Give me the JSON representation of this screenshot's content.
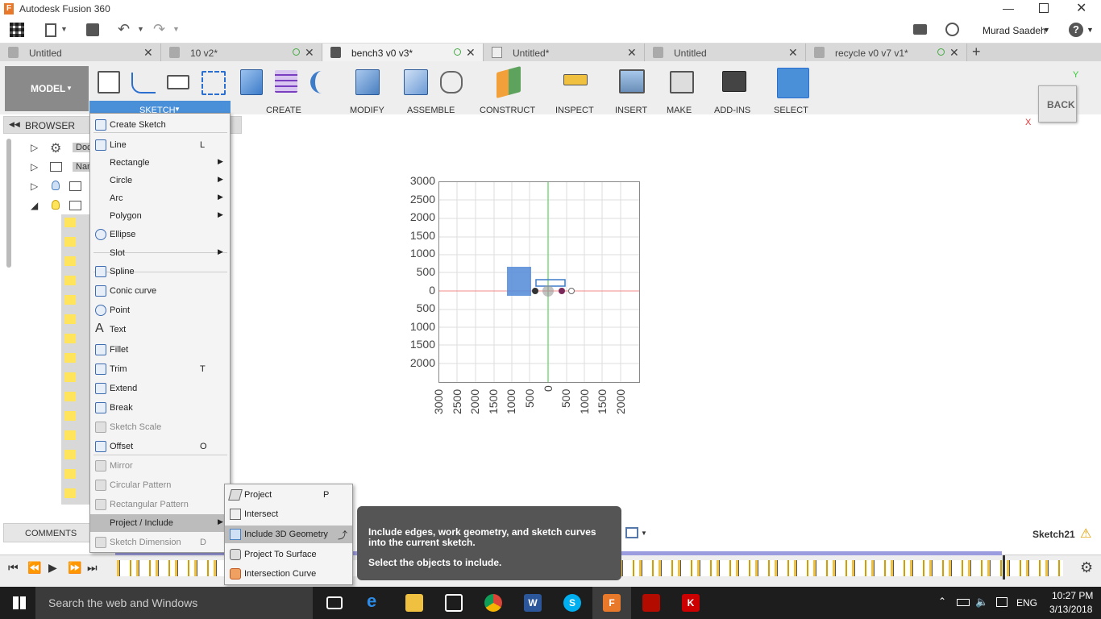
{
  "app": {
    "title": "Autodesk Fusion 360",
    "user": "Murad Saadeh"
  },
  "tabs": [
    {
      "label": "Untitled"
    },
    {
      "label": "10 v2*"
    },
    {
      "label": "bench3 v0 v3*"
    },
    {
      "label": "Untitled*"
    },
    {
      "label": "Untitled"
    },
    {
      "label": "recycle v0 v7 v1*"
    }
  ],
  "ribbon": {
    "workspace": "MODEL",
    "groups": [
      "SKETCH",
      "CREATE",
      "MODIFY",
      "ASSEMBLE",
      "CONSTRUCT",
      "INSPECT",
      "INSERT",
      "MAKE",
      "ADD-INS",
      "SELECT"
    ]
  },
  "browser": {
    "title": "BROWSER",
    "rows": [
      "Doc",
      "Nam"
    ]
  },
  "comments": {
    "label": "COMMENTS"
  },
  "sketch_menu": {
    "items": [
      {
        "label": "Create Sketch",
        "shortcut": "",
        "submenu": false,
        "disabled": false
      },
      {
        "label": "Line",
        "shortcut": "L",
        "submenu": false,
        "disabled": false
      },
      {
        "label": "Rectangle",
        "shortcut": "",
        "submenu": true,
        "disabled": false
      },
      {
        "label": "Circle",
        "shortcut": "",
        "submenu": true,
        "disabled": false
      },
      {
        "label": "Arc",
        "shortcut": "",
        "submenu": true,
        "disabled": false
      },
      {
        "label": "Polygon",
        "shortcut": "",
        "submenu": true,
        "disabled": false
      },
      {
        "label": "Ellipse",
        "shortcut": "",
        "submenu": false,
        "disabled": false
      },
      {
        "label": "Slot",
        "shortcut": "",
        "submenu": true,
        "disabled": false
      },
      {
        "label": "Spline",
        "shortcut": "",
        "submenu": false,
        "disabled": false
      },
      {
        "label": "Conic curve",
        "shortcut": "",
        "submenu": false,
        "disabled": false
      },
      {
        "label": "Point",
        "shortcut": "",
        "submenu": false,
        "disabled": false
      },
      {
        "label": "Text",
        "shortcut": "",
        "submenu": false,
        "disabled": false
      },
      {
        "label": "Fillet",
        "shortcut": "",
        "submenu": false,
        "disabled": false
      },
      {
        "label": "Trim",
        "shortcut": "T",
        "submenu": false,
        "disabled": false
      },
      {
        "label": "Extend",
        "shortcut": "",
        "submenu": false,
        "disabled": false
      },
      {
        "label": "Break",
        "shortcut": "",
        "submenu": false,
        "disabled": false
      },
      {
        "label": "Sketch Scale",
        "shortcut": "",
        "submenu": false,
        "disabled": true
      },
      {
        "label": "Offset",
        "shortcut": "O",
        "submenu": false,
        "disabled": false
      },
      {
        "label": "Mirror",
        "shortcut": "",
        "submenu": false,
        "disabled": true
      },
      {
        "label": "Circular Pattern",
        "shortcut": "",
        "submenu": false,
        "disabled": true
      },
      {
        "label": "Rectangular Pattern",
        "shortcut": "",
        "submenu": false,
        "disabled": true
      },
      {
        "label": "Project / Include",
        "shortcut": "",
        "submenu": true,
        "disabled": false
      },
      {
        "label": "Sketch Dimension",
        "shortcut": "D",
        "submenu": false,
        "disabled": true
      }
    ]
  },
  "project_submenu": {
    "items": [
      {
        "label": "Project",
        "shortcut": "P"
      },
      {
        "label": "Intersect",
        "shortcut": ""
      },
      {
        "label": "Include 3D Geometry",
        "shortcut": ""
      },
      {
        "label": "Project To Surface",
        "shortcut": ""
      },
      {
        "label": "Intersection Curve",
        "shortcut": ""
      }
    ]
  },
  "tooltip": {
    "line1": "Include edges, work geometry, and sketch curves into the current sketch.",
    "line2": "Select the objects to include."
  },
  "viewport": {
    "y_ticks": [
      "3000",
      "2500",
      "2000",
      "1500",
      "1000",
      "500",
      "0",
      "500",
      "1000",
      "1500",
      "2000"
    ],
    "x_ticks": [
      "3000",
      "2500",
      "2000",
      "1500",
      "1000",
      "500",
      "0",
      "500",
      "1000",
      "1500",
      "2000"
    ]
  },
  "viewcube": {
    "label": "BACK",
    "axis_x": "X",
    "axis_y": "Y"
  },
  "status": {
    "sketch_name": "Sketch21"
  },
  "taskbar": {
    "search_placeholder": "Search the web and Windows",
    "language": "ENG",
    "time": "10:27 PM",
    "date": "3/13/2018"
  },
  "colors": {
    "accent": "#0696d7",
    "menu_highlight": "#bcbcbc",
    "tooltip_bg": "#555555"
  }
}
